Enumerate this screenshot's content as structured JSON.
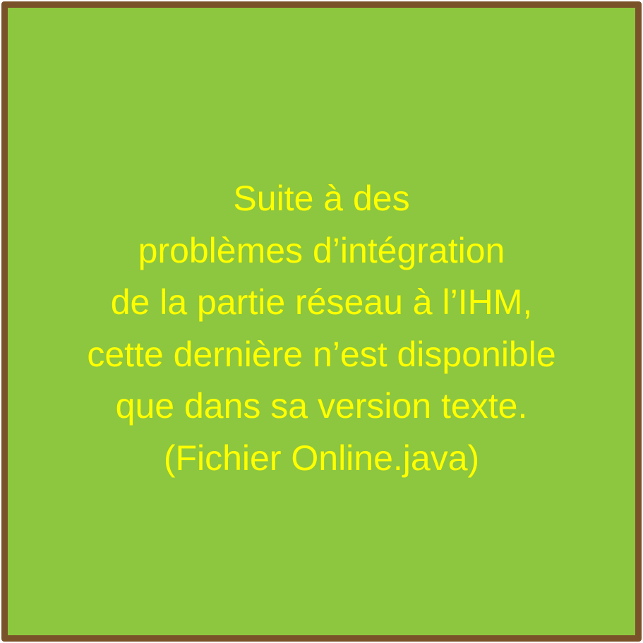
{
  "colors": {
    "border": "#7a5229",
    "background": "#8dc63f",
    "text": "#ffff00"
  },
  "message": {
    "lines": [
      "Suite à des",
      "problèmes d’intégration",
      "de la partie réseau à l’IHM,",
      "cette dernière n’est disponible",
      "que dans sa version texte.",
      "(Fichier Online.java)"
    ]
  }
}
